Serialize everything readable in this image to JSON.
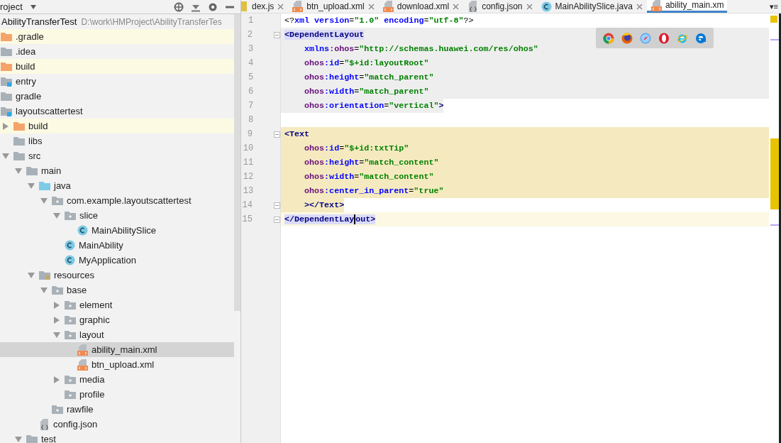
{
  "project_panel": {
    "title": "roject",
    "root": {
      "name": "AbilityTransferTest",
      "path": "D:\\work\\HMProject\\AbilityTransferTes"
    },
    "tree": [
      {
        "name": ".gradle",
        "kind": "folder-excluded",
        "excluded": true,
        "selected": false
      },
      {
        "name": ".idea",
        "kind": "folder",
        "excluded": false,
        "selected": false
      },
      {
        "name": "build",
        "kind": "folder-excluded",
        "excluded": true,
        "selected": false
      },
      {
        "name": "entry",
        "kind": "module",
        "excluded": false,
        "selected": false
      },
      {
        "name": "gradle",
        "kind": "folder",
        "excluded": false,
        "selected": false
      },
      {
        "name": "layoutscattertest",
        "kind": "module",
        "excluded": false,
        "selected": false,
        "children": [
          {
            "name": "build",
            "kind": "folder-excluded",
            "excluded": true,
            "selected": false,
            "expanded": false
          },
          {
            "name": "libs",
            "kind": "folder",
            "excluded": false,
            "selected": false
          },
          {
            "name": "src",
            "kind": "folder",
            "excluded": false,
            "selected": false,
            "expanded": true,
            "children": [
              {
                "name": "main",
                "kind": "folder",
                "excluded": false,
                "selected": false,
                "expanded": true,
                "children": [
                  {
                    "name": "java",
                    "kind": "source",
                    "excluded": false,
                    "selected": false,
                    "expanded": true,
                    "children": [
                      {
                        "name": "com.example.layoutscattertest",
                        "kind": "package",
                        "excluded": false,
                        "selected": false,
                        "expanded": true,
                        "children": [
                          {
                            "name": "slice",
                            "kind": "package",
                            "excluded": false,
                            "selected": false,
                            "expanded": true,
                            "children": [
                              {
                                "name": "MainAbilitySlice",
                                "kind": "class",
                                "excluded": false,
                                "selected": false
                              }
                            ]
                          },
                          {
                            "name": "MainAbility",
                            "kind": "class",
                            "excluded": false,
                            "selected": false
                          },
                          {
                            "name": "MyApplication",
                            "kind": "class",
                            "excluded": false,
                            "selected": false
                          }
                        ]
                      }
                    ]
                  },
                  {
                    "name": "resources",
                    "kind": "resources",
                    "excluded": false,
                    "selected": false,
                    "expanded": true,
                    "children": [
                      {
                        "name": "base",
                        "kind": "package",
                        "excluded": false,
                        "selected": false,
                        "expanded": true,
                        "children": [
                          {
                            "name": "element",
                            "kind": "package",
                            "excluded": false,
                            "selected": false,
                            "expanded": false
                          },
                          {
                            "name": "graphic",
                            "kind": "package",
                            "excluded": false,
                            "selected": false,
                            "expanded": false
                          },
                          {
                            "name": "layout",
                            "kind": "package",
                            "excluded": false,
                            "selected": false,
                            "expanded": true,
                            "children": [
                              {
                                "name": "ability_main.xml",
                                "kind": "xml",
                                "excluded": false,
                                "selected": true
                              },
                              {
                                "name": "btn_upload.xml",
                                "kind": "xml",
                                "excluded": false,
                                "selected": false
                              }
                            ]
                          },
                          {
                            "name": "media",
                            "kind": "package",
                            "excluded": false,
                            "selected": false,
                            "expanded": false
                          },
                          {
                            "name": "profile",
                            "kind": "package",
                            "excluded": false,
                            "selected": false
                          }
                        ]
                      },
                      {
                        "name": "rawfile",
                        "kind": "package",
                        "excluded": false,
                        "selected": false
                      }
                    ]
                  },
                  {
                    "name": "config.json",
                    "kind": "json",
                    "excluded": false,
                    "selected": false
                  }
                ]
              },
              {
                "name": "test",
                "kind": "folder",
                "excluded": false,
                "selected": false,
                "expanded": true
              }
            ]
          }
        ]
      }
    ]
  },
  "editor": {
    "tabs": [
      {
        "label": "dex.js",
        "kind": "js",
        "selected": false
      },
      {
        "label": "btn_upload.xml",
        "kind": "xml",
        "selected": false
      },
      {
        "label": "download.xml",
        "kind": "xml",
        "selected": false
      },
      {
        "label": "config.json",
        "kind": "json",
        "selected": false
      },
      {
        "label": "MainAbilitySlice.java",
        "kind": "class",
        "selected": false
      },
      {
        "label": "ability_main.xm",
        "kind": "xml",
        "selected": true
      }
    ],
    "tab_menu": "▾≡",
    "lines": [
      {
        "number": "1",
        "kind": "none",
        "fold": false,
        "tokens": [
          {
            "kind": "plain",
            "text": "<?"
          },
          {
            "kind": "attr",
            "text": "xml version"
          },
          {
            "kind": "plain",
            "text": "="
          },
          {
            "kind": "value",
            "text": "\"1.0\""
          },
          {
            "kind": "attr",
            "text": " encoding"
          },
          {
            "kind": "plain",
            "text": "="
          },
          {
            "kind": "value",
            "text": "\"utf-8\""
          },
          {
            "kind": "plain",
            "text": "?>"
          }
        ]
      },
      {
        "number": "2",
        "kind": "block",
        "fold": true,
        "tokens": [
          {
            "kind": "tag",
            "text": "<DependentLayout",
            "match": true
          }
        ]
      },
      {
        "number": "3",
        "kind": "block",
        "fold": false,
        "tokens": [
          {
            "kind": "attr",
            "text": "    xmlns"
          },
          {
            "kind": "ns",
            "text": ":ohos"
          },
          {
            "kind": "plain",
            "text": "="
          },
          {
            "kind": "value",
            "text": "\"http://schemas.huawei.com/res/ohos\""
          }
        ]
      },
      {
        "number": "4",
        "kind": "block",
        "fold": false,
        "tokens": [
          {
            "kind": "ns",
            "text": "    ohos"
          },
          {
            "kind": "attr",
            "text": ":id"
          },
          {
            "kind": "plain",
            "text": "="
          },
          {
            "kind": "value",
            "text": "\"$+id:layoutRoot\""
          }
        ]
      },
      {
        "number": "5",
        "kind": "block",
        "fold": false,
        "tokens": [
          {
            "kind": "ns",
            "text": "    ohos"
          },
          {
            "kind": "attr",
            "text": ":height"
          },
          {
            "kind": "plain",
            "text": "="
          },
          {
            "kind": "value",
            "text": "\"match_parent\""
          }
        ]
      },
      {
        "number": "6",
        "kind": "block",
        "fold": false,
        "tokens": [
          {
            "kind": "ns",
            "text": "    ohos"
          },
          {
            "kind": "attr",
            "text": ":width"
          },
          {
            "kind": "plain",
            "text": "="
          },
          {
            "kind": "value",
            "text": "\"match_parent\""
          }
        ]
      },
      {
        "number": "7",
        "kind": "block-end",
        "fold": false,
        "tokens": [
          {
            "kind": "ns",
            "text": "    ohos"
          },
          {
            "kind": "attr",
            "text": ":orientation"
          },
          {
            "kind": "plain",
            "text": "="
          },
          {
            "kind": "value",
            "text": "\"vertical\""
          },
          {
            "kind": "tag",
            "text": ">"
          }
        ]
      },
      {
        "number": "8",
        "kind": "none",
        "fold": false
      },
      {
        "number": "9",
        "kind": "text",
        "fold": true,
        "tokens": [
          {
            "kind": "tag",
            "text": "<Text"
          }
        ]
      },
      {
        "number": "10",
        "kind": "text",
        "fold": false,
        "tokens": [
          {
            "kind": "ns",
            "text": "    ohos"
          },
          {
            "kind": "attr",
            "text": ":id"
          },
          {
            "kind": "plain",
            "text": "="
          },
          {
            "kind": "value",
            "text": "\"$+id:txtTip\""
          }
        ]
      },
      {
        "number": "11",
        "kind": "text",
        "fold": false,
        "tokens": [
          {
            "kind": "ns",
            "text": "    ohos"
          },
          {
            "kind": "attr",
            "text": ":height"
          },
          {
            "kind": "plain",
            "text": "="
          },
          {
            "kind": "value",
            "text": "\"match_content\""
          }
        ]
      },
      {
        "number": "12",
        "kind": "text",
        "fold": false,
        "tokens": [
          {
            "kind": "ns",
            "text": "    ohos"
          },
          {
            "kind": "attr",
            "text": ":width"
          },
          {
            "kind": "plain",
            "text": "="
          },
          {
            "kind": "value",
            "text": "\"match_content\""
          }
        ]
      },
      {
        "number": "13",
        "kind": "text",
        "fold": false,
        "tokens": [
          {
            "kind": "ns",
            "text": "    ohos"
          },
          {
            "kind": "attr",
            "text": ":center_in_parent"
          },
          {
            "kind": "plain",
            "text": "="
          },
          {
            "kind": "value",
            "text": "\"true\""
          }
        ]
      },
      {
        "number": "14",
        "kind": "text-end",
        "fold": true,
        "tokens": [
          {
            "kind": "tag",
            "text": "    ></Text>"
          }
        ]
      },
      {
        "number": "15",
        "kind": "caret",
        "fold": true,
        "tokens": [
          {
            "kind": "tag",
            "text": "</DependentLay",
            "match": true
          },
          {
            "kind": "caret"
          },
          {
            "kind": "tag",
            "text": "out>",
            "match": true
          }
        ]
      }
    ],
    "browsers": [
      {
        "kind": "chrome"
      },
      {
        "kind": "firefox"
      },
      {
        "kind": "safari"
      },
      {
        "kind": "opera"
      },
      {
        "kind": "ie"
      },
      {
        "kind": "edge"
      }
    ]
  }
}
